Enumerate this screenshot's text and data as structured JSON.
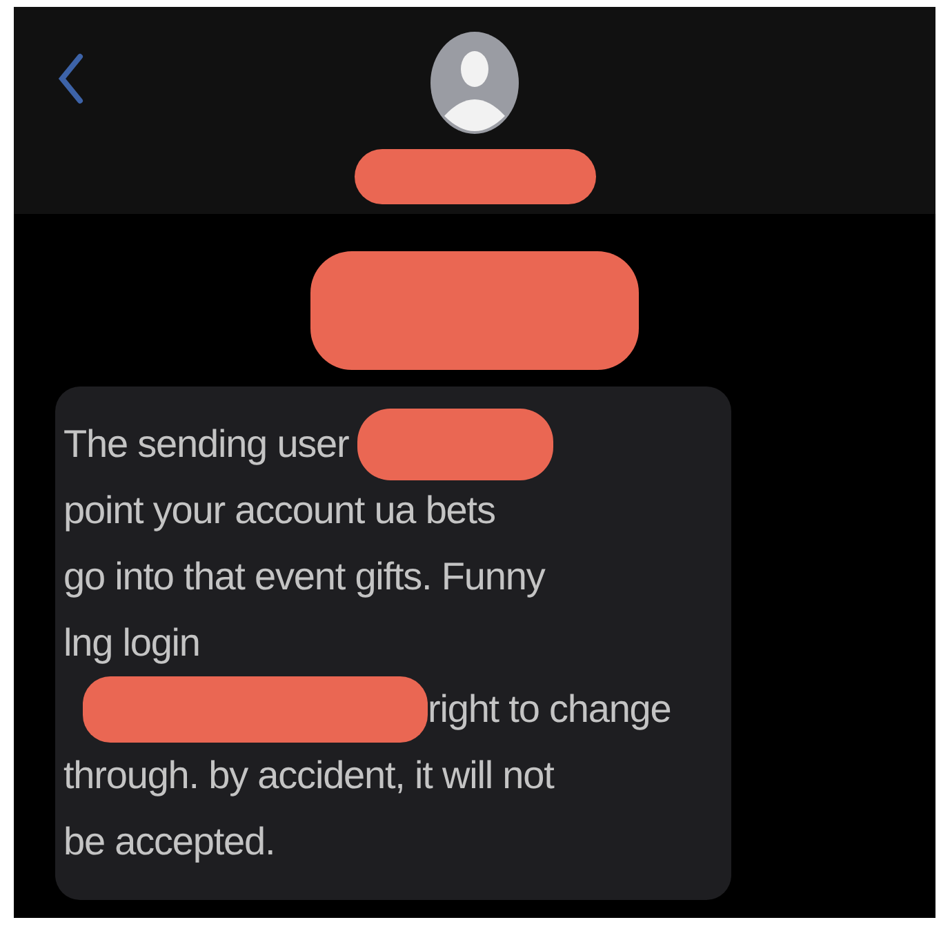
{
  "header": {
    "name": {
      "kind": "redaction"
    }
  },
  "timestamp": {
    "kind": "redaction"
  },
  "message": {
    "lines": [
      {
        "segments": [
          {
            "kind": "text",
            "text": "The sending user"
          },
          {
            "kind": "redaction"
          }
        ]
      },
      {
        "segments": [
          {
            "kind": "text",
            "text": "point your account ua bets"
          }
        ]
      },
      {
        "segments": [
          {
            "kind": "text",
            "text": "go into that event gifts. Funny"
          }
        ]
      },
      {
        "segments": [
          {
            "kind": "text",
            "text": "lng login"
          }
        ]
      },
      {
        "segments": [
          {
            "kind": "redaction"
          },
          {
            "kind": "text",
            "text": "right to change"
          }
        ]
      },
      {
        "segments": [
          {
            "kind": "text",
            "text": "through. by accident, it will not"
          }
        ]
      },
      {
        "segments": [
          {
            "kind": "text",
            "text": "be accepted."
          }
        ]
      }
    ]
  }
}
